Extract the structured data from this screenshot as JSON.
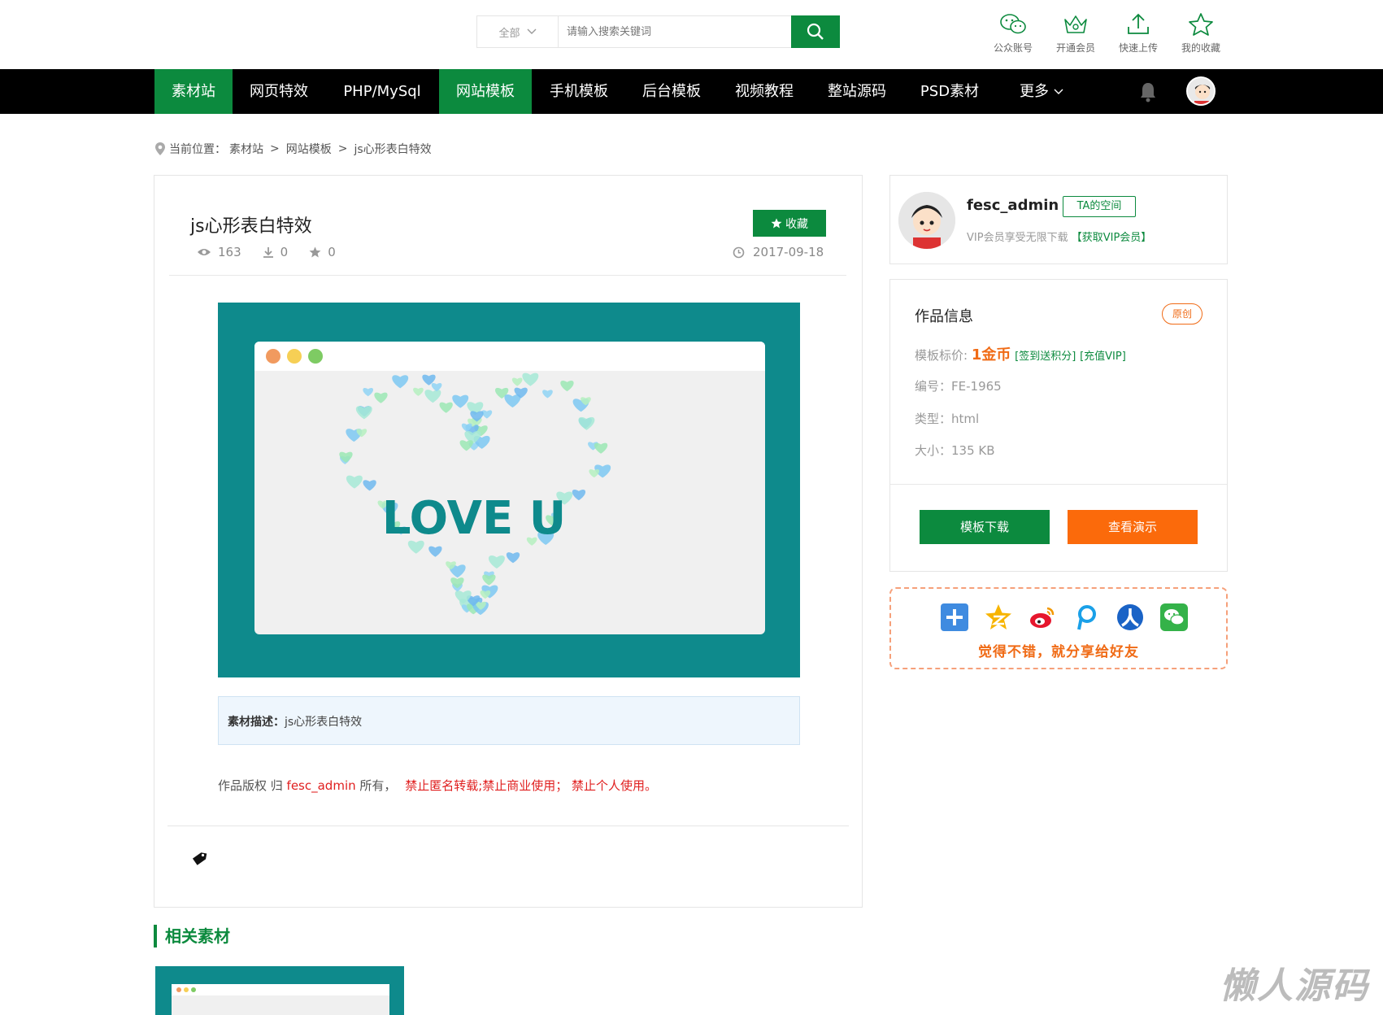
{
  "header": {
    "search": {
      "category": "全部",
      "placeholder": "请输入搜索关键词"
    },
    "tools": [
      {
        "label": "公众账号",
        "icon": "wechat-icon"
      },
      {
        "label": "开通会员",
        "icon": "crown-icon"
      },
      {
        "label": "快速上传",
        "icon": "upload-icon"
      },
      {
        "label": "我的收藏",
        "icon": "star-icon"
      }
    ]
  },
  "nav": {
    "items": [
      "素材站",
      "网页特效",
      "PHP/MySql",
      "网站模板",
      "手机模板",
      "后台模板",
      "视频教程",
      "整站源码",
      "PSD素材",
      "更多"
    ]
  },
  "breadcrumb": {
    "prefix": "当前位置：",
    "items": [
      "素材站",
      "网站模板",
      "js心形表白特效"
    ],
    "sep": ">"
  },
  "article": {
    "title": "js心形表白特效",
    "views": "163",
    "downloads": "0",
    "favorites": "0",
    "date": "2017-09-18",
    "fav_button": "收藏",
    "preview_text": "LOVE U",
    "desc_label": "素材描述：",
    "desc_value": "js心形表白特效",
    "copyright_prefix": "作品版权 归 ",
    "copyright_author": "fesc_admin",
    "copyright_mid": " 所有，",
    "copyright_rule": "禁止匿名转载;禁止商业使用；  禁止个人使用。"
  },
  "related": {
    "title": "相关素材"
  },
  "author": {
    "name": "fesc_admin",
    "space_button": "TA的空间",
    "vip_text": "VIP会员享受无限下载",
    "vip_link": "【获取VIP会员】"
  },
  "info": {
    "title": "作品信息",
    "badge": "原创",
    "price_label": "模板标价: ",
    "price_value": "1金币",
    "price_link1": "[签到送积分]",
    "price_link2": "[充值VIP]",
    "id_label": "编号：",
    "id_value": "FE-1965",
    "type_label": "类型：",
    "type_value": "html",
    "size_label": "大小：",
    "size_value": "135 KB",
    "download_button": "模板下载",
    "demo_button": "查看演示"
  },
  "share": {
    "text": "觉得不错，就分享给好友"
  },
  "watermark": "懒人源码",
  "colors": {
    "brand_green": "#0c8a3e",
    "orange": "#fb6a0b",
    "teal": "#0e8a8c"
  }
}
